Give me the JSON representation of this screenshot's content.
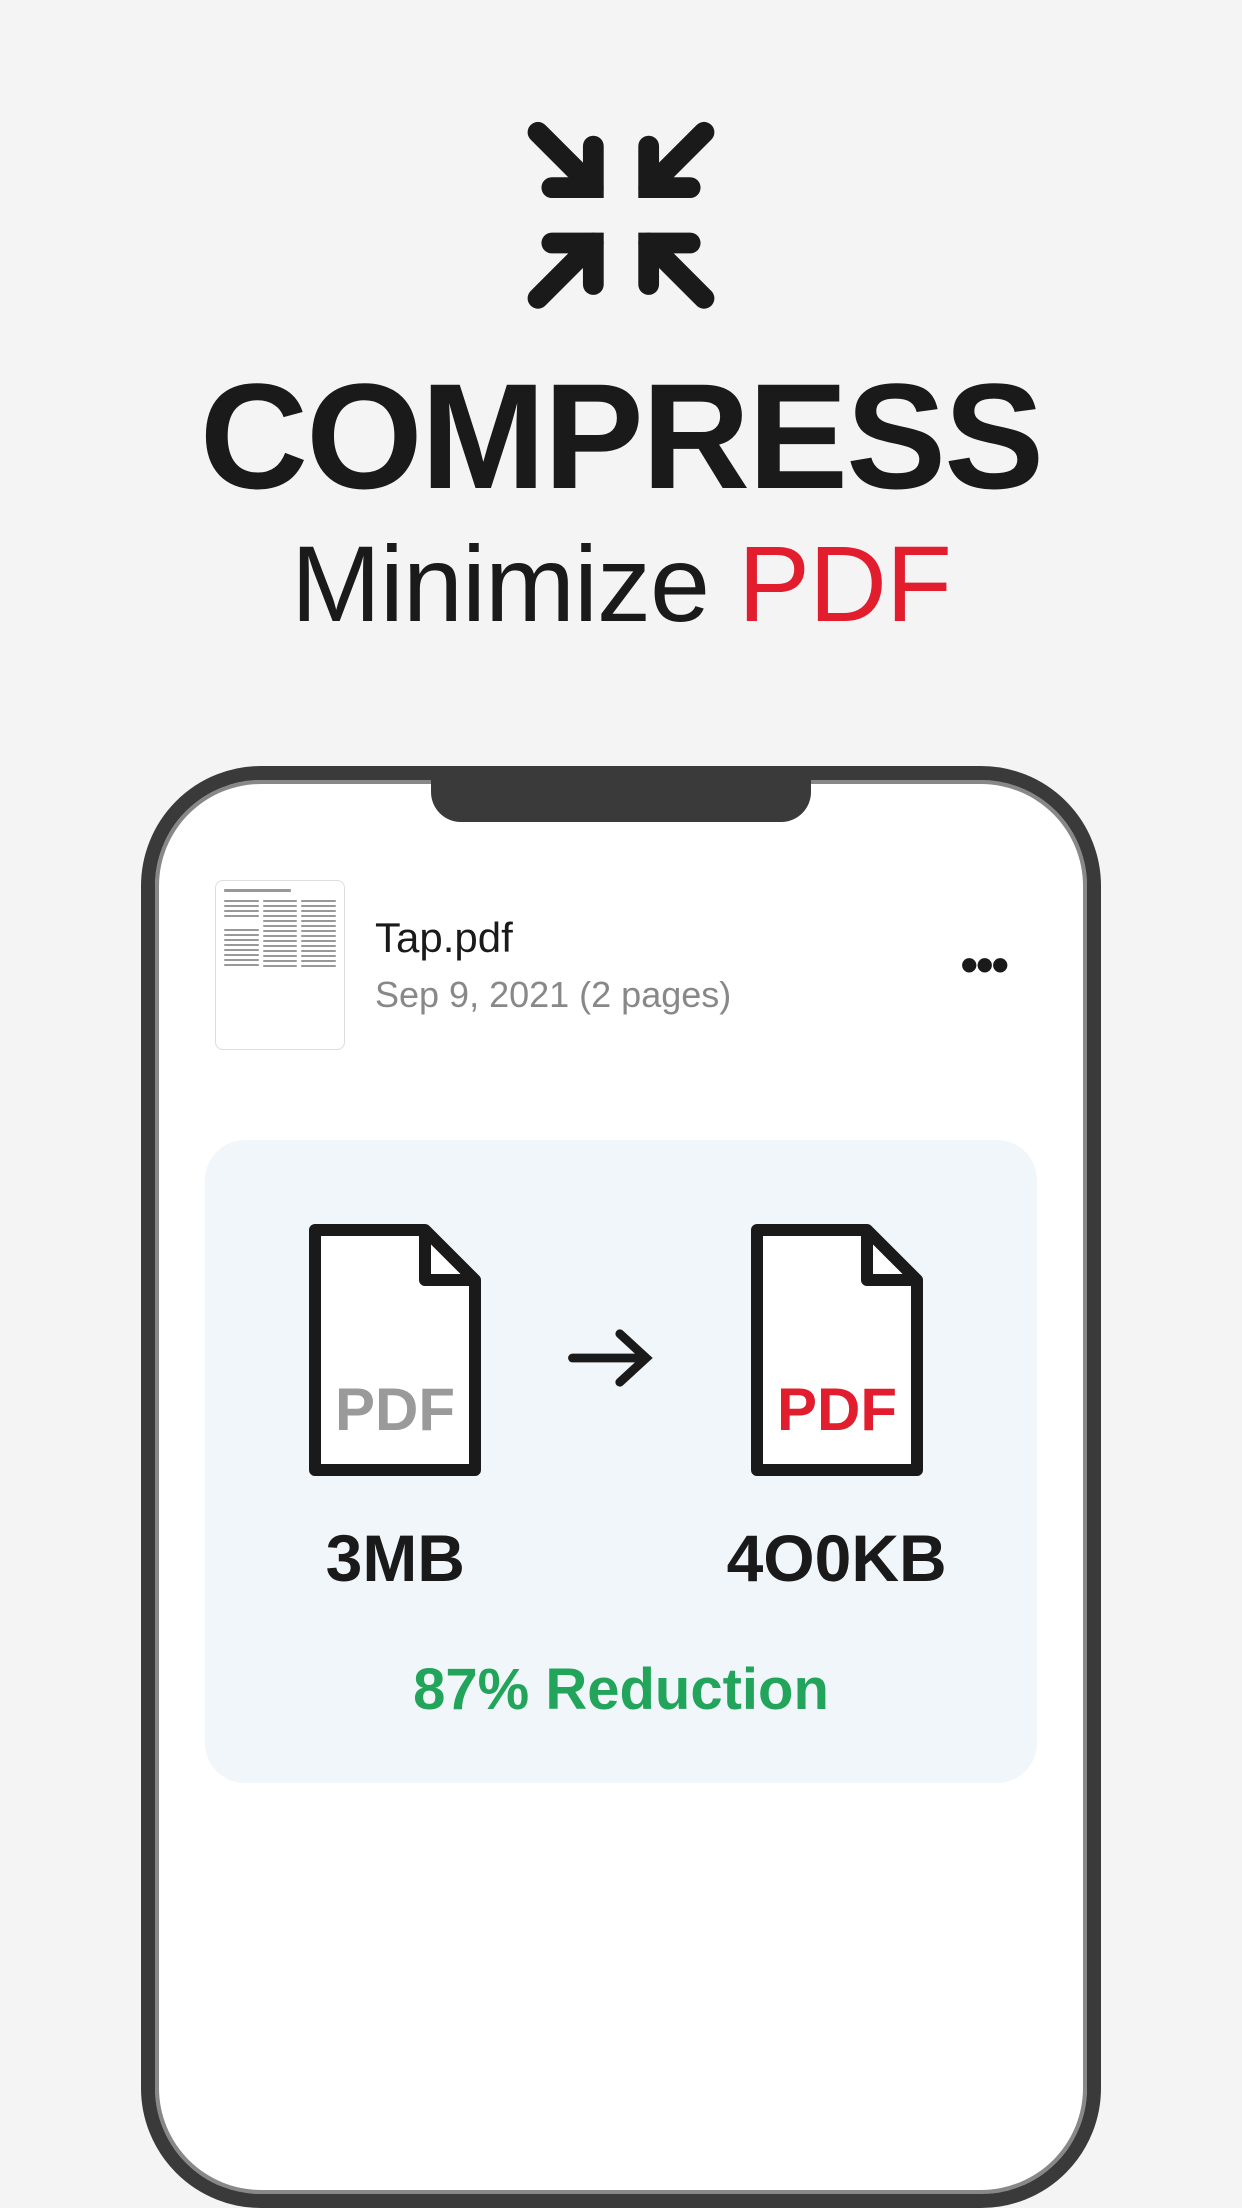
{
  "header": {
    "title": "COMPRESS",
    "subtitle_prefix": "Minimize ",
    "subtitle_highlight": "PDF"
  },
  "file": {
    "name": "Tap.pdf",
    "meta": "Sep 9, 2021 (2 pages)"
  },
  "comparison": {
    "before_size": "3MB",
    "before_label": "PDF",
    "after_size": "4O0KB",
    "after_label": "PDF",
    "reduction": "87% Reduction"
  },
  "colors": {
    "red": "#e11d2e",
    "green": "#22a55a",
    "gray": "#9a9a9a"
  }
}
